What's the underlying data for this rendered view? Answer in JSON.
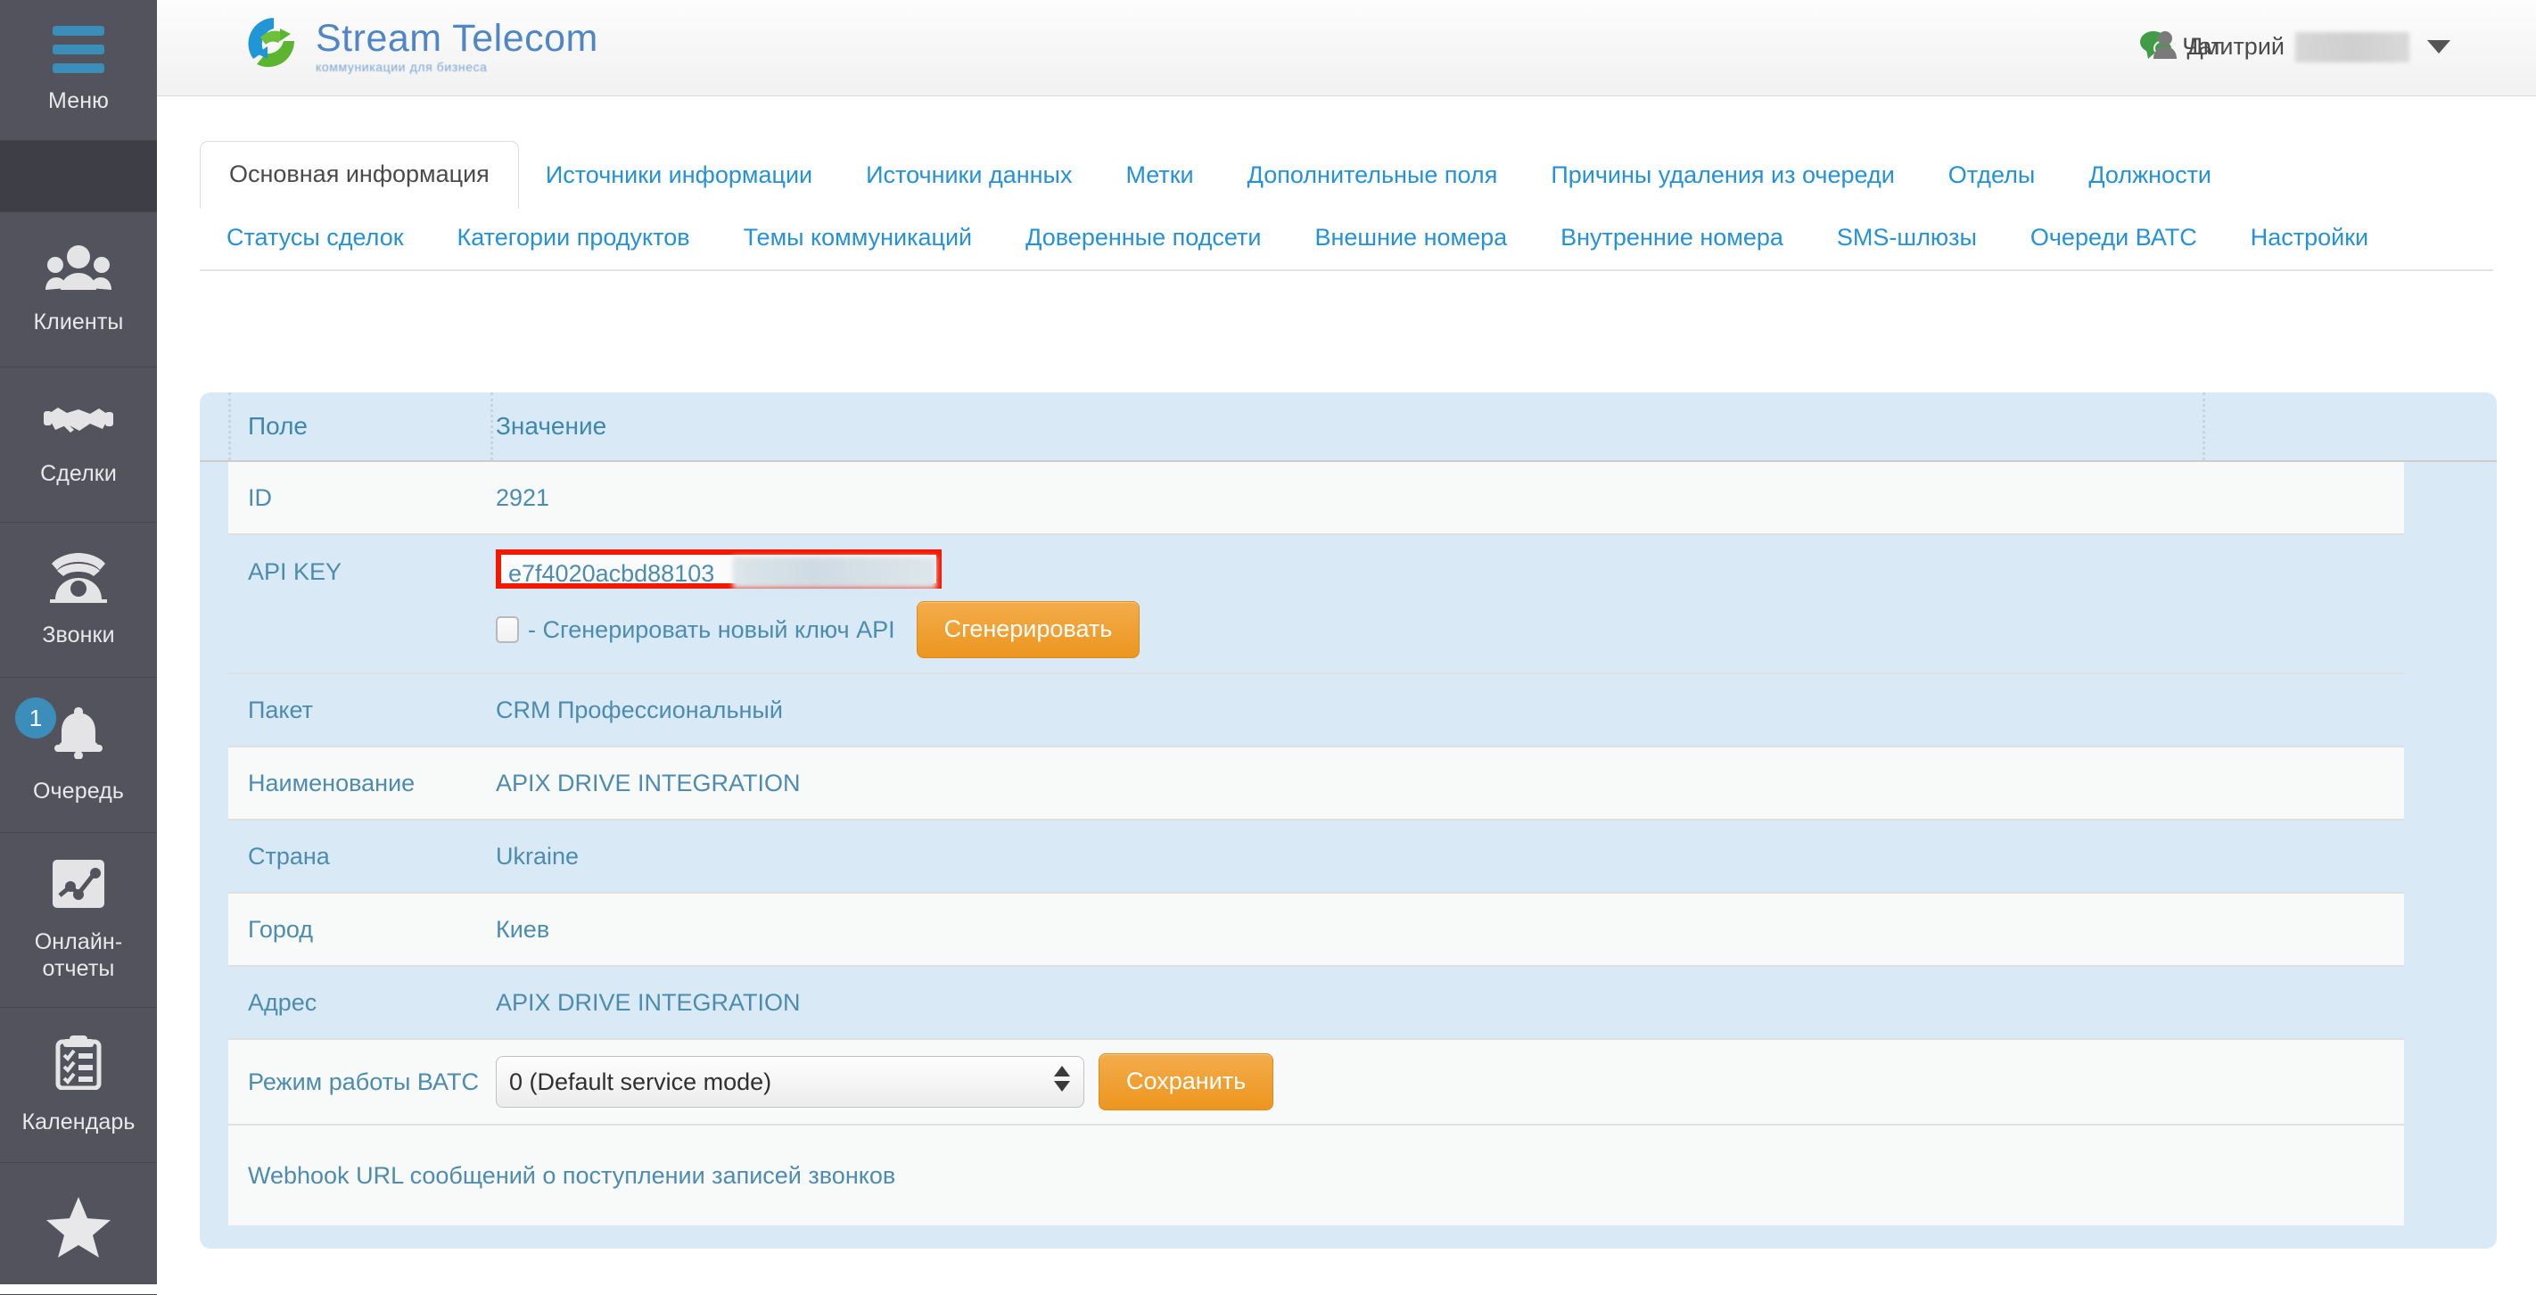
{
  "sidebar": {
    "menu": {
      "label": "Меню",
      "icon": "hamburger-icon"
    },
    "items": [
      {
        "label": "Клиенты",
        "icon": "users-icon"
      },
      {
        "label": "Сделки",
        "icon": "handshake-icon"
      },
      {
        "label": "Звонки",
        "icon": "telephone-icon"
      },
      {
        "label": "Очередь",
        "icon": "bell-icon",
        "badge": "1"
      },
      {
        "label": "Онлайн-отчеты",
        "icon": "chart-image-icon"
      },
      {
        "label": "Календарь",
        "icon": "clipboard-check-icon"
      },
      {
        "label": "",
        "icon": "star-icon"
      }
    ]
  },
  "header": {
    "brand_name": "Stream Telecom",
    "brand_tagline": "коммуникации для бизнеса",
    "chat_label": "Чат",
    "chat_icon": "chat-bubble-icon",
    "user_icon": "person-icon",
    "user_name": "Дмитрий",
    "user_surname_redacted": "",
    "caret_icon": "chevron-down-icon"
  },
  "tabs_row1": [
    {
      "label": "Основная информация",
      "active": true
    },
    {
      "label": "Источники информации",
      "active": false
    },
    {
      "label": "Источники данных",
      "active": false
    },
    {
      "label": "Метки",
      "active": false
    },
    {
      "label": "Дополнительные поля",
      "active": false
    },
    {
      "label": "Причины удаления из очереди",
      "active": false
    },
    {
      "label": "Отделы",
      "active": false
    }
  ],
  "tabs_row2": [
    {
      "label": "Должности"
    },
    {
      "label": "Статусы сделок"
    },
    {
      "label": "Категории продуктов"
    },
    {
      "label": "Темы коммуникаций"
    },
    {
      "label": "Доверенные подсети"
    },
    {
      "label": "Внешние номера"
    },
    {
      "label": "Внутренние номера"
    }
  ],
  "tabs_row3": [
    {
      "label": "SMS-шлюзы"
    },
    {
      "label": "Очереди ВАТС"
    },
    {
      "label": "Настройки"
    }
  ],
  "table": {
    "columns": {
      "field": "Поле",
      "value": "Значение"
    },
    "rows": {
      "id": {
        "label": "ID",
        "value": "2921"
      },
      "apikey": {
        "label": "API KEY",
        "value": "e7f4020acbd88103"
      },
      "package": {
        "label": "Пакет",
        "value": "CRM Профессиональный"
      },
      "name": {
        "label": "Наименование",
        "value": "APIX DRIVE INTEGRATION"
      },
      "country": {
        "label": "Страна",
        "value": "Ukraine"
      },
      "city": {
        "label": "Город",
        "value": "Киев"
      },
      "address": {
        "label": "Адрес",
        "value": "APIX DRIVE INTEGRATION"
      },
      "mode": {
        "label": "Режим работы ВАТС",
        "value": "0 (Default service mode)"
      },
      "webhook": {
        "label": "Webhook URL сообщений о поступлении записей звонков",
        "value": ""
      }
    }
  },
  "apikey_controls": {
    "checkbox_caption": "- Сгенерировать новый ключ API",
    "generate_button": "Сгенерировать"
  },
  "mode_controls": {
    "selected_option": "0 (Default service mode)",
    "save_button": "Сохранить"
  },
  "colors": {
    "sidebar_bg": "#53535e",
    "accent_blue": "#3b8dba",
    "link_blue": "#2491d8",
    "table_text": "#4c8cb0",
    "panel_bg": "#d9eaf6",
    "button_orange": "#ec961f",
    "annotation_red": "#f51800",
    "chat_green": "#429b46"
  }
}
